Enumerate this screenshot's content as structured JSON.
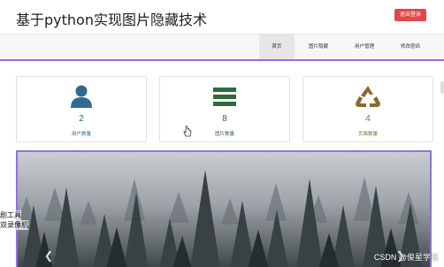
{
  "header": {
    "title": "基于python实现图片隐藏技术",
    "logout_label": "退出登录"
  },
  "nav": {
    "items": [
      {
        "label": "首页",
        "active": true
      },
      {
        "label": "图片隐藏",
        "active": false
      },
      {
        "label": "用户管理",
        "active": false
      },
      {
        "label": "修改密码",
        "active": false
      }
    ]
  },
  "cards": [
    {
      "icon": "user-icon",
      "count": "2",
      "label": "用户数量",
      "color": "#2e6b8f"
    },
    {
      "icon": "list-icon",
      "count": "8",
      "label": "图片数量",
      "color": "#2f6b3a"
    },
    {
      "icon": "recycle-icon",
      "count": "4",
      "label": "页面数量",
      "color": "#8a6a2e"
    }
  ],
  "overlay": {
    "side_line1": "剧工具",
    "side_line2": "双录像机",
    "watermark": "CSDN @俊星学长"
  },
  "colors": {
    "accent": "#9370db",
    "logout": "#e0494a"
  }
}
